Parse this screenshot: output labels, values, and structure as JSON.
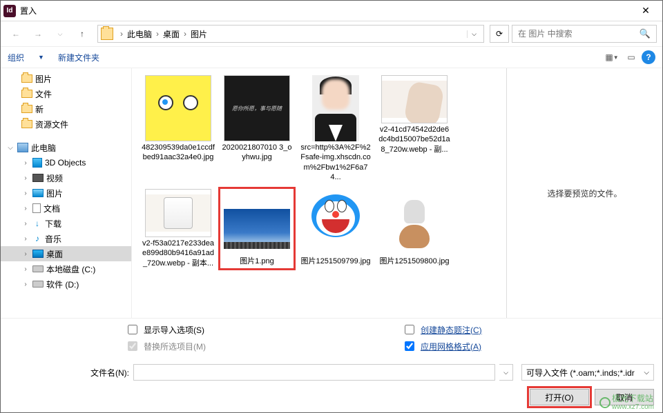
{
  "title": "置入",
  "breadcrumb": {
    "seg1": "此电脑",
    "seg2": "桌面",
    "seg3": "图片"
  },
  "search": {
    "placeholder": "在 图片 中搜索"
  },
  "toolbar": {
    "organize": "组织",
    "newfolder": "新建文件夹"
  },
  "sidebar": {
    "items": [
      {
        "label": "图片"
      },
      {
        "label": "文件"
      },
      {
        "label": "新"
      },
      {
        "label": "资源文件"
      },
      {
        "label": "此电脑"
      },
      {
        "label": "3D Objects"
      },
      {
        "label": "视频"
      },
      {
        "label": "图片"
      },
      {
        "label": "文档"
      },
      {
        "label": "下载"
      },
      {
        "label": "音乐"
      },
      {
        "label": "桌面"
      },
      {
        "label": "本地磁盘 (C:)"
      },
      {
        "label": "软件 (D:)"
      }
    ]
  },
  "files": [
    {
      "name": "482309539da0e1ccdfbed91aac32a4e0.jpg"
    },
    {
      "name": "2020021807010 3_oyhwu.jpg"
    },
    {
      "name": "src=http%3A%2F%2Fsafe-img.xhscdn.com%2Fbw1%2F6a74..."
    },
    {
      "name": "v2-41cd74542d2de6dc4bd15007be52d1a8_720w.webp - 副..."
    },
    {
      "name": "v2-f53a0217e233deae899d80b9416a91ad_720w.webp - 副本..."
    },
    {
      "name": "图片1.png"
    },
    {
      "name": "图片1251509799.jpg"
    },
    {
      "name": "图片1251509800.jpg"
    }
  ],
  "preview_text": "选择要预览的文件。",
  "options": {
    "show_import": "显示导入选项(S)",
    "create_static": "创建静态题注(C)",
    "replace_selected": "替换所选项目(M)",
    "apply_grid": "应用网格格式(A)"
  },
  "filename_label": "文件名(N):",
  "filter_label": "可导入文件 (*.oam;*.inds;*.idr",
  "buttons": {
    "open": "打开(O)",
    "cancel": "取消"
  },
  "watermark": {
    "text": "极光下载站",
    "url": "www.xz7.com"
  }
}
